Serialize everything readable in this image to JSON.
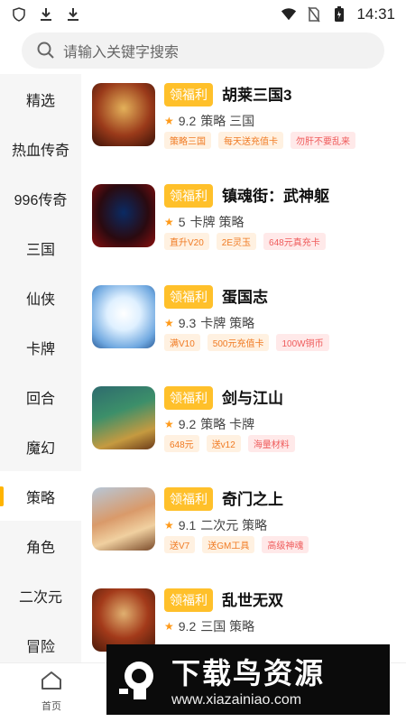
{
  "status": {
    "time": "14:31"
  },
  "search": {
    "placeholder": "请输入关键字搜索"
  },
  "sidebar": {
    "items": [
      {
        "label": "精选"
      },
      {
        "label": "热血传奇"
      },
      {
        "label": "996传奇"
      },
      {
        "label": "三国"
      },
      {
        "label": "仙侠"
      },
      {
        "label": "卡牌"
      },
      {
        "label": "回合"
      },
      {
        "label": "魔幻"
      },
      {
        "label": "策略",
        "active": true
      },
      {
        "label": "角色"
      },
      {
        "label": "二次元"
      },
      {
        "label": "冒险"
      }
    ]
  },
  "games": [
    {
      "button": "领福利",
      "name": "胡莱三国3",
      "rating": "9.2",
      "genres": "策略 三国",
      "tags": [
        {
          "text": "策略三国",
          "style": "orange"
        },
        {
          "text": "每天送充值卡",
          "style": "orange"
        },
        {
          "text": "勿肝不要乱来",
          "style": "pink"
        }
      ]
    },
    {
      "button": "领福利",
      "name": "镇魂街：武神躯",
      "rating": "5",
      "genres": "卡牌 策略",
      "tags": [
        {
          "text": "直升V20",
          "style": "orange"
        },
        {
          "text": "2E灵玉",
          "style": "orange"
        },
        {
          "text": "648元真充卡",
          "style": "pink"
        }
      ]
    },
    {
      "button": "领福利",
      "name": "蛋国志",
      "rating": "9.3",
      "genres": "卡牌 策略",
      "tags": [
        {
          "text": "满V10",
          "style": "orange"
        },
        {
          "text": "500元充值卡",
          "style": "orange"
        },
        {
          "text": "100W铜币",
          "style": "pink"
        }
      ]
    },
    {
      "button": "领福利",
      "name": "剑与江山",
      "rating": "9.2",
      "genres": "策略 卡牌",
      "tags": [
        {
          "text": "648元",
          "style": "orange"
        },
        {
          "text": "送v12",
          "style": "orange"
        },
        {
          "text": "海量材料",
          "style": "pink"
        }
      ]
    },
    {
      "button": "领福利",
      "name": "奇门之上",
      "rating": "9.1",
      "genres": "二次元 策略",
      "tags": [
        {
          "text": "送V7",
          "style": "orange"
        },
        {
          "text": "送GM工具",
          "style": "orange"
        },
        {
          "text": "高级神魂",
          "style": "pink"
        }
      ]
    },
    {
      "button": "领福利",
      "name": "乱世无双",
      "rating": "9.2",
      "genres": "三国 策略",
      "tags": []
    }
  ],
  "tabbar": {
    "home_label": "首页"
  },
  "watermark": {
    "title": "下载鸟资源",
    "url": "www.xiazainiao.com"
  },
  "colors": {
    "accent": "#ffc02a",
    "tag_orange": "#f07a22",
    "tag_pink": "#ef5b5b",
    "star": "#ff9a1a"
  }
}
